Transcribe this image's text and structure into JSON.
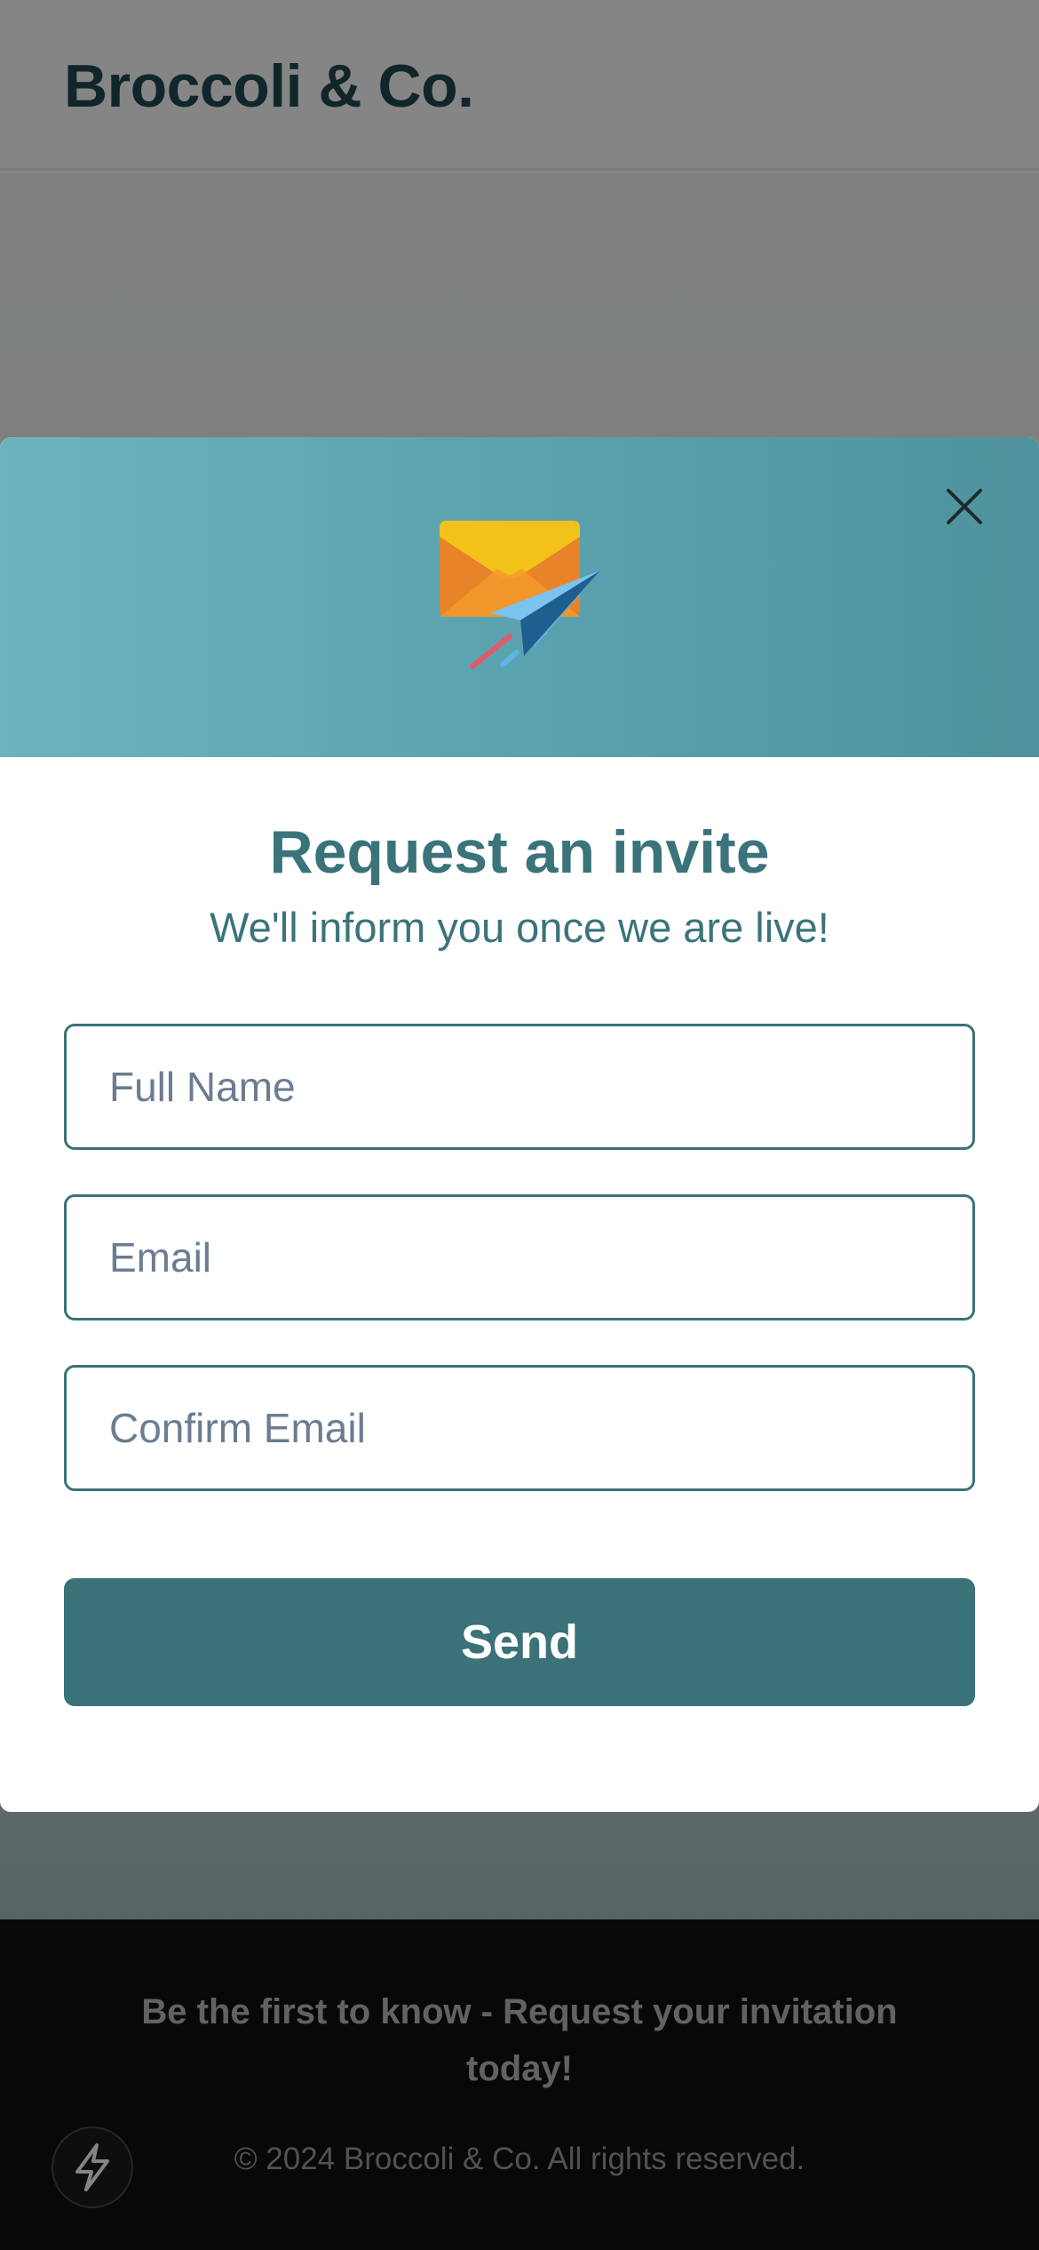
{
  "header": {
    "brand": "Broccoli & Co."
  },
  "modal": {
    "title": "Request an invite",
    "subtitle": "We'll inform you once we are live!",
    "fields": {
      "full_name_placeholder": "Full Name",
      "email_placeholder": "Email",
      "confirm_email_placeholder": "Confirm Email"
    },
    "send_label": "Send",
    "icons": {
      "banner": "envelope-paper-plane-icon",
      "close": "close-icon"
    }
  },
  "footer": {
    "tagline": "Be the first to know - Request your invitation today!",
    "copyright": "© 2024 Broccoli & Co. All rights reserved.",
    "icon": "lightning-icon"
  },
  "colors": {
    "brand": "#1f4a52",
    "primary": "#3a7278",
    "banner_start": "#6cb3bd",
    "banner_end": "#4f929d",
    "footer_bg": "#111111"
  }
}
